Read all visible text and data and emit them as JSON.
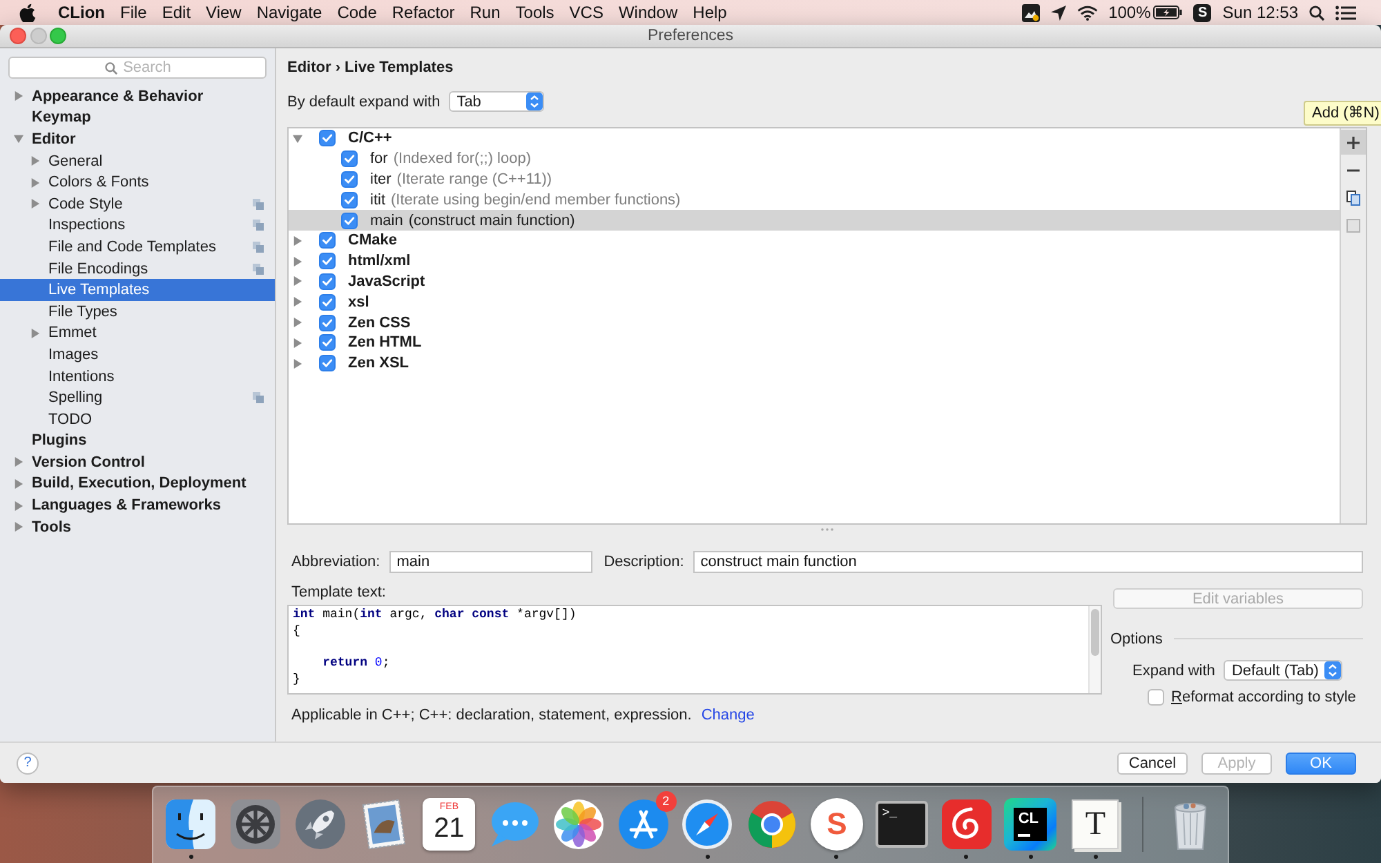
{
  "menu_bar": {
    "app_name": "CLion",
    "menus": [
      "File",
      "Edit",
      "View",
      "Navigate",
      "Code",
      "Refactor",
      "Run",
      "Tools",
      "VCS",
      "Window",
      "Help"
    ],
    "battery": "100%",
    "tray_letter": "S",
    "clock": "Sun 12:53"
  },
  "window": {
    "title": "Preferences",
    "controls": [
      {
        "kind": "close",
        "disabled": false
      },
      {
        "kind": "minimize",
        "disabled": true
      },
      {
        "kind": "zoom",
        "disabled": false
      }
    ]
  },
  "sidebar": {
    "search": {
      "placeholder": "Search"
    },
    "items": [
      {
        "label": "Appearance & Behavior",
        "expanded": false,
        "selected": false
      },
      {
        "label": "Keymap",
        "selected": false
      },
      {
        "label": "Editor",
        "expanded": true,
        "selected": false,
        "children": [
          {
            "label": "General",
            "expanded": false,
            "selected": false,
            "project_scope": false
          },
          {
            "label": "Colors & Fonts",
            "expanded": false,
            "selected": false,
            "project_scope": false
          },
          {
            "label": "Code Style",
            "expanded": false,
            "selected": false,
            "project_scope": true
          },
          {
            "label": "Inspections",
            "selected": false,
            "project_scope": true
          },
          {
            "label": "File and Code Templates",
            "selected": false,
            "project_scope": true
          },
          {
            "label": "File Encodings",
            "selected": false,
            "project_scope": true
          },
          {
            "label": "Live Templates",
            "selected": true,
            "project_scope": false
          },
          {
            "label": "File Types",
            "selected": false,
            "project_scope": false
          },
          {
            "label": "Emmet",
            "expanded": false,
            "selected": false,
            "project_scope": false
          },
          {
            "label": "Images",
            "selected": false,
            "project_scope": false
          },
          {
            "label": "Intentions",
            "selected": false,
            "project_scope": false
          },
          {
            "label": "Spelling",
            "selected": false,
            "project_scope": true
          },
          {
            "label": "TODO",
            "selected": false,
            "project_scope": false
          }
        ]
      },
      {
        "label": "Plugins",
        "selected": false
      },
      {
        "label": "Version Control",
        "expanded": false,
        "selected": false
      },
      {
        "label": "Build, Execution, Deployment",
        "expanded": false,
        "selected": false
      },
      {
        "label": "Languages & Frameworks",
        "expanded": false,
        "selected": false
      },
      {
        "label": "Tools",
        "expanded": false,
        "selected": false
      }
    ]
  },
  "breadcrumb": "Editor › Live Templates",
  "expand_default": {
    "label": "By default expand with",
    "value": "Tab"
  },
  "templates": {
    "groups": [
      {
        "name": "C/C++",
        "checked": true,
        "expanded": true,
        "selected": false,
        "children": [
          {
            "abbreviation": "for",
            "description": "(Indexed for(;;) loop)",
            "checked": true,
            "selected": false
          },
          {
            "abbreviation": "iter",
            "description": "(Iterate range (C++11))",
            "checked": true,
            "selected": false
          },
          {
            "abbreviation": "itit",
            "description": "(Iterate using begin/end member functions)",
            "checked": true,
            "selected": false
          },
          {
            "abbreviation": "main",
            "description": "(construct main function)",
            "checked": true,
            "selected": true
          }
        ]
      },
      {
        "name": "CMake",
        "checked": true,
        "expanded": false,
        "selected": false
      },
      {
        "name": "html/xml",
        "checked": true,
        "expanded": false,
        "selected": false
      },
      {
        "name": "JavaScript",
        "checked": true,
        "expanded": false,
        "selected": false
      },
      {
        "name": "xsl",
        "checked": true,
        "expanded": false,
        "selected": false
      },
      {
        "name": "Zen CSS",
        "checked": true,
        "expanded": false,
        "selected": false
      },
      {
        "name": "Zen HTML",
        "checked": true,
        "expanded": false,
        "selected": false
      },
      {
        "name": "Zen XSL",
        "checked": true,
        "expanded": false,
        "selected": false
      }
    ],
    "tools": [
      {
        "kind": "add",
        "hovered": true,
        "disabled": false
      },
      {
        "kind": "remove",
        "hovered": false,
        "disabled": false
      },
      {
        "kind": "copy",
        "hovered": false,
        "disabled": false
      },
      {
        "kind": "square",
        "hovered": false,
        "disabled": true
      }
    ],
    "tooltip": "Add (⌘N)"
  },
  "details": {
    "abbreviation": {
      "label": "Abbreviation:",
      "value": "main"
    },
    "description": {
      "label": "Description:",
      "value": "construct main function"
    },
    "template_label": "Template text:",
    "code_lines": [
      {
        "kind": "code",
        "tokens": [
          {
            "text": "int",
            "kind": "keyword"
          },
          {
            "text": " main(",
            "kind": "plain"
          },
          {
            "text": "int",
            "kind": "keyword"
          },
          {
            "text": " argc, ",
            "kind": "plain"
          },
          {
            "text": "char const",
            "kind": "keyword"
          },
          {
            "text": " *argv[])",
            "kind": "plain"
          }
        ]
      },
      {
        "kind": "code",
        "tokens": [
          {
            "text": "{",
            "kind": "plain"
          }
        ]
      },
      {
        "kind": "blank"
      },
      {
        "kind": "code",
        "indented": true,
        "tokens": [
          {
            "text": "return",
            "kind": "keyword"
          },
          {
            "text": " 0",
            "kind": "number"
          },
          {
            "text": ";",
            "kind": "plain"
          }
        ]
      },
      {
        "kind": "code",
        "tokens": [
          {
            "text": "}",
            "kind": "plain"
          }
        ]
      }
    ],
    "edit_variables": {
      "label": "Edit variables",
      "disabled": true
    },
    "options": {
      "title": "Options",
      "expand": {
        "label": "Expand with",
        "value": "Default (Tab)"
      },
      "reformat": {
        "label": "Reformat according to style",
        "checked": false
      }
    },
    "applicable": {
      "text": "Applicable in C++; C++: declaration, statement, expression.",
      "link": "Change"
    }
  },
  "footer": {
    "help": "?",
    "buttons": [
      {
        "label": "Cancel",
        "kind": "normal",
        "disabled": false
      },
      {
        "label": "Apply",
        "kind": "normal",
        "disabled": true
      },
      {
        "label": "OK",
        "kind": "default",
        "disabled": false
      }
    ]
  },
  "dock": {
    "apps": [
      {
        "kind": "finder",
        "running": true
      },
      {
        "kind": "gear",
        "running": false
      },
      {
        "kind": "rocket",
        "running": false
      },
      {
        "kind": "stamp",
        "running": false
      },
      {
        "kind": "calendar",
        "month": "FEB",
        "day": "21",
        "running": false
      },
      {
        "kind": "chat",
        "running": false
      },
      {
        "kind": "flower",
        "running": false
      },
      {
        "kind": "store",
        "badge": "2",
        "running": false
      },
      {
        "kind": "compass",
        "running": true
      },
      {
        "kind": "browser",
        "running": false
      },
      {
        "kind": "letter",
        "label": "S",
        "running": true
      },
      {
        "kind": "terminal",
        "label": ">_",
        "running": false
      },
      {
        "kind": "music",
        "running": true
      },
      {
        "kind": "ide",
        "label": "CL",
        "running": true
      },
      {
        "kind": "paper",
        "label": "T",
        "running": true
      },
      {
        "kind": "trash",
        "running": false
      }
    ]
  }
}
